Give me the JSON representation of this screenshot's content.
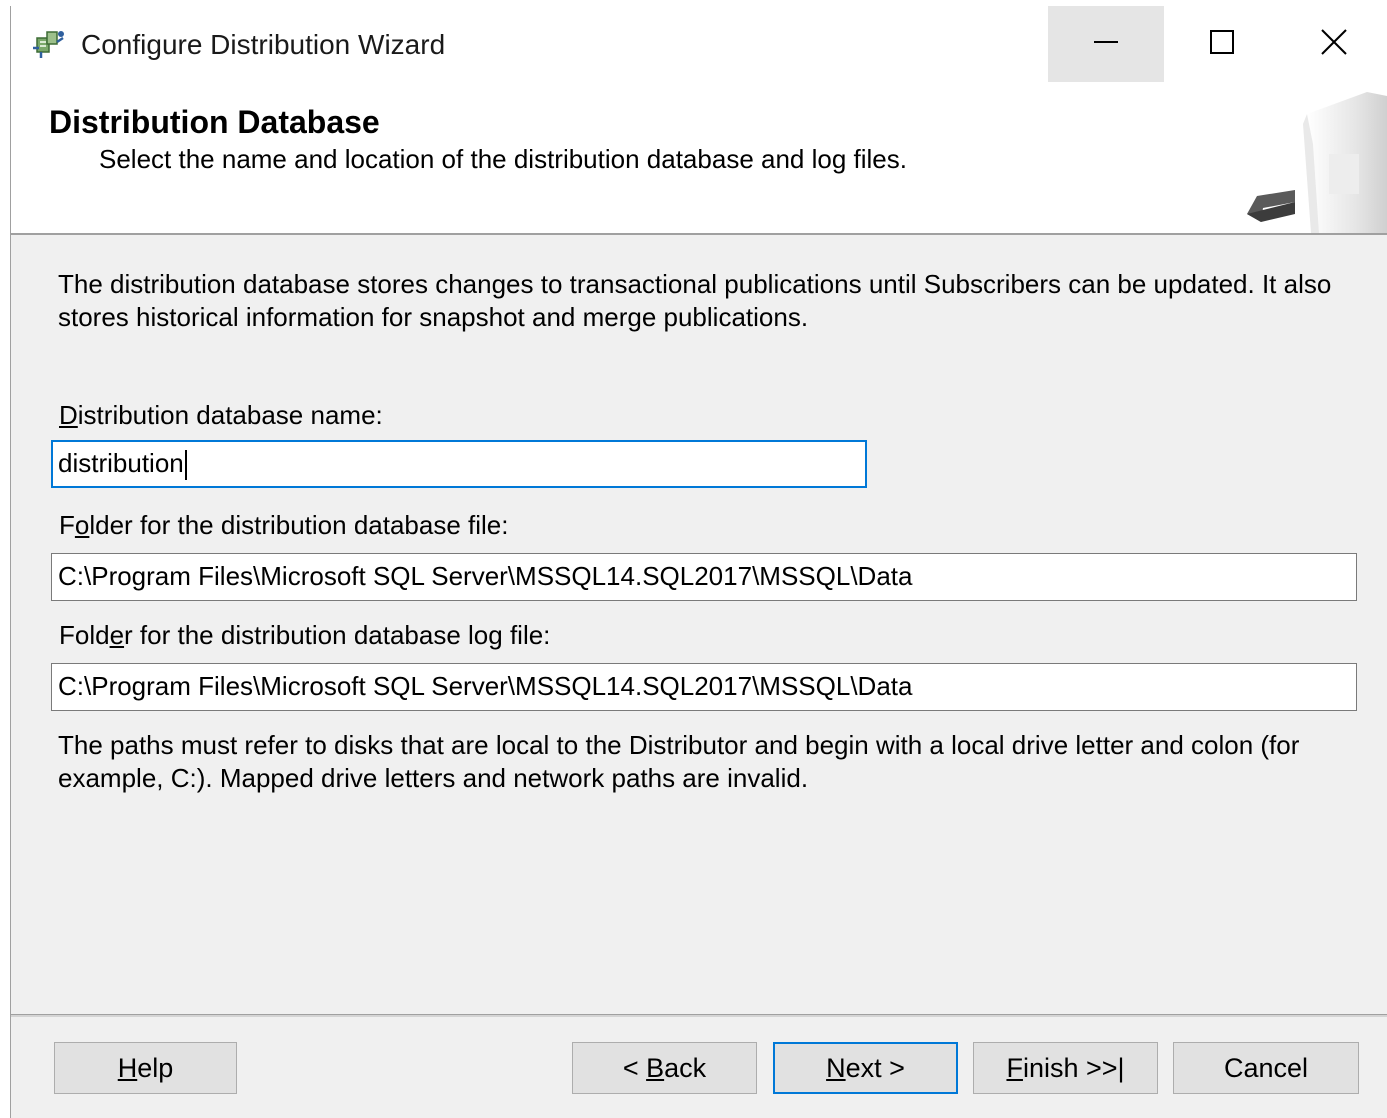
{
  "window": {
    "title": "Configure Distribution Wizard",
    "controls": {
      "minimize": "minimize",
      "maximize": "maximize",
      "close": "close"
    }
  },
  "header": {
    "title": "Distribution Database",
    "subtitle": "Select the name and location of the distribution database and log files."
  },
  "content": {
    "description": "The distribution database stores changes to transactional publications until Subscribers can be updated. It also stores historical information for snapshot and merge publications.",
    "db_name": {
      "label_mnemonic": "D",
      "label_rest": "istribution database name:",
      "value": "distribution"
    },
    "data_folder": {
      "label_pre": "F",
      "label_mnemonic": "o",
      "label_rest": "lder for the distribution database file:",
      "value": "C:\\Program Files\\Microsoft SQL Server\\MSSQL14.SQL2017\\MSSQL\\Data"
    },
    "log_folder": {
      "label_pre": "Fold",
      "label_mnemonic": "e",
      "label_rest": "r for the distribution database log file:",
      "value": "C:\\Program Files\\Microsoft SQL Server\\MSSQL14.SQL2017\\MSSQL\\Data"
    },
    "note": "The paths must refer to disks that are local to the Distributor and begin with a local drive letter and colon (for example, C:). Mapped drive letters and network paths are invalid."
  },
  "buttons": {
    "help": {
      "mnemonic": "H",
      "rest": "elp"
    },
    "back": {
      "pre": "< ",
      "mnemonic": "B",
      "rest": "ack"
    },
    "next": {
      "mnemonic": "N",
      "rest": "ext >"
    },
    "finish": {
      "mnemonic": "F",
      "rest": "inish >>|"
    },
    "cancel": {
      "label": "Cancel"
    }
  },
  "colors": {
    "focus_border": "#0078d7",
    "window_bg": "#f0f0f0",
    "button_bg": "#e1e1e1"
  }
}
